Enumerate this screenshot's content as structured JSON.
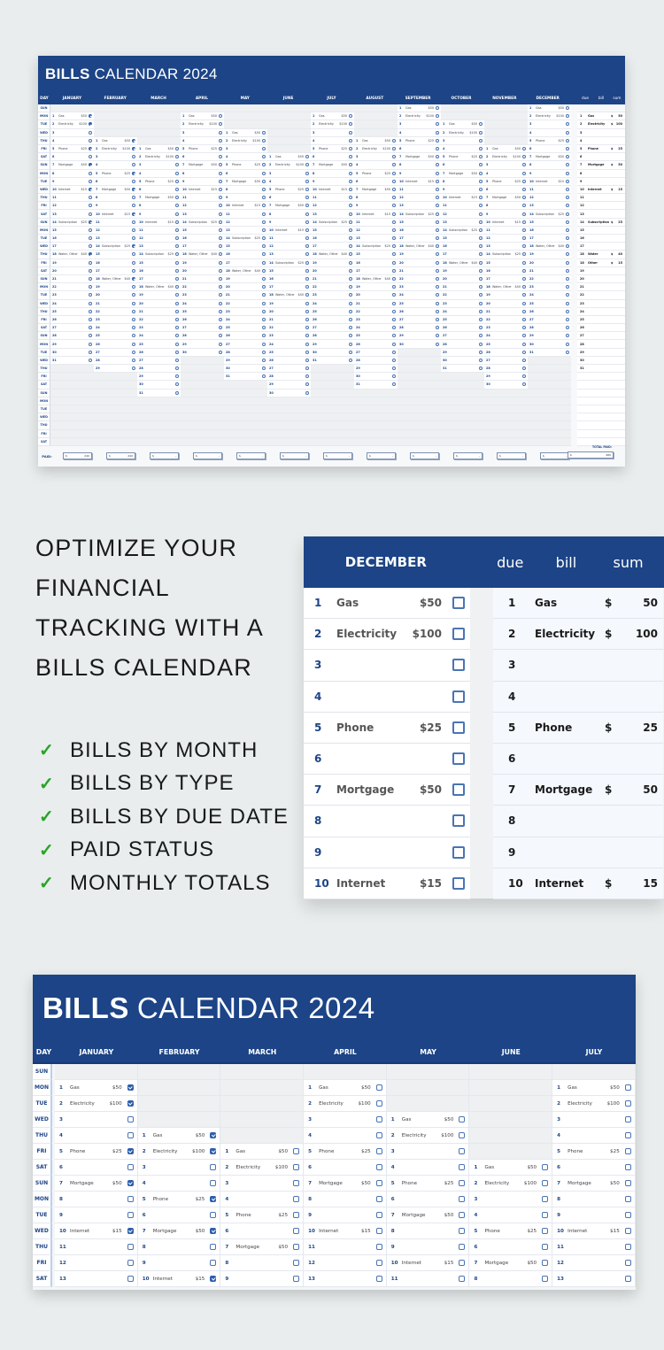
{
  "top_calendar": {
    "title_bold": "BILLS",
    "title_light": "CALENDAR 2024",
    "day_header": "DAY",
    "months": [
      "JANUARY",
      "FEBRUARY",
      "MARCH",
      "APRIL",
      "MAY",
      "JUNE",
      "JULY",
      "AUGUST",
      "SEPTEMBER",
      "OCTOBER",
      "NOVEMBER",
      "DECEMBER"
    ],
    "summary_headers": [
      "due",
      "bill",
      "sum"
    ],
    "weekdays": [
      "SUN",
      "MON",
      "TUE",
      "WED",
      "THU",
      "FRI",
      "SAT"
    ],
    "paid_label": "PAID:",
    "paid_values": [
      "$ 240",
      "$ 240",
      "$ -",
      "$ -",
      "$ -",
      "$ -",
      "$ -",
      "$ -",
      "$ -",
      "$ -",
      "$ -",
      "$ -"
    ],
    "total_paid_label": "TOTAL PAID:",
    "total_paid_value": "$ 480",
    "summary": [
      {
        "due": "1",
        "bill": "Gas",
        "cur": "$",
        "sum": "50"
      },
      {
        "due": "2",
        "bill": "Electricity",
        "cur": "$",
        "sum": "100"
      },
      {
        "due": "3",
        "bill": "",
        "cur": "",
        "sum": ""
      },
      {
        "due": "4",
        "bill": "",
        "cur": "",
        "sum": ""
      },
      {
        "due": "5",
        "bill": "Phone",
        "cur": "$",
        "sum": "25"
      },
      {
        "due": "6",
        "bill": "",
        "cur": "",
        "sum": ""
      },
      {
        "due": "7",
        "bill": "Mortgage",
        "cur": "$",
        "sum": "50"
      },
      {
        "due": "8",
        "bill": "",
        "cur": "",
        "sum": ""
      },
      {
        "due": "9",
        "bill": "",
        "cur": "",
        "sum": ""
      },
      {
        "due": "10",
        "bill": "Internet",
        "cur": "$",
        "sum": "15"
      },
      {
        "due": "11",
        "bill": "",
        "cur": "",
        "sum": ""
      },
      {
        "due": "12",
        "bill": "",
        "cur": "",
        "sum": ""
      },
      {
        "due": "13",
        "bill": "",
        "cur": "",
        "sum": ""
      },
      {
        "due": "14",
        "bill": "Subscription",
        "cur": "$",
        "sum": "25"
      },
      {
        "due": "15",
        "bill": "",
        "cur": "",
        "sum": ""
      },
      {
        "due": "16",
        "bill": "",
        "cur": "",
        "sum": ""
      },
      {
        "due": "17",
        "bill": "",
        "cur": "",
        "sum": ""
      },
      {
        "due": "18",
        "bill": "Water",
        "cur": "$",
        "sum": "40"
      },
      {
        "due": "18",
        "bill": "Other",
        "cur": "$",
        "sum": "15"
      },
      {
        "due": "19",
        "bill": "",
        "cur": "",
        "sum": ""
      },
      {
        "due": "20",
        "bill": "",
        "cur": "",
        "sum": ""
      },
      {
        "due": "21",
        "bill": "",
        "cur": "",
        "sum": ""
      },
      {
        "due": "22",
        "bill": "",
        "cur": "",
        "sum": ""
      },
      {
        "due": "23",
        "bill": "",
        "cur": "",
        "sum": ""
      },
      {
        "due": "24",
        "bill": "",
        "cur": "",
        "sum": ""
      },
      {
        "due": "25",
        "bill": "",
        "cur": "",
        "sum": ""
      },
      {
        "due": "26",
        "bill": "",
        "cur": "",
        "sum": ""
      },
      {
        "due": "27",
        "bill": "",
        "cur": "",
        "sum": ""
      },
      {
        "due": "28",
        "bill": "",
        "cur": "",
        "sum": ""
      },
      {
        "due": "29",
        "bill": "",
        "cur": "",
        "sum": ""
      },
      {
        "due": "30",
        "bill": "",
        "cur": "",
        "sum": ""
      },
      {
        "due": "31",
        "bill": "",
        "cur": "",
        "sum": ""
      }
    ]
  },
  "calendar_2024": {
    "month_start_weekday": [
      1,
      4,
      5,
      1,
      3,
      6,
      1,
      4,
      0,
      2,
      5,
      0
    ],
    "month_days": [
      31,
      29,
      31,
      30,
      31,
      30,
      31,
      31,
      30,
      31,
      30,
      31
    ],
    "checked_months": [
      0,
      1
    ],
    "bills": [
      {
        "day": 1,
        "name": "Gas",
        "amount": "$50"
      },
      {
        "day": 2,
        "name": "Electricity",
        "amount": "$100"
      },
      {
        "day": 5,
        "name": "Phone",
        "amount": "$25"
      },
      {
        "day": 7,
        "name": "Mortgage",
        "amount": "$50"
      },
      {
        "day": 10,
        "name": "Internet",
        "amount": "$15"
      },
      {
        "day": 14,
        "name": "Subscription",
        "amount": "$25"
      },
      {
        "day": 18,
        "name": "Water, Other",
        "amount": "$40"
      }
    ]
  },
  "marketing": {
    "headline_lines": [
      "OPTIMIZE YOUR",
      "FINANCIAL",
      "TRACKING WITH A",
      "BILLS CALENDAR"
    ],
    "check_icon": "✓",
    "features": [
      "BILLS BY MONTH",
      "BILLS BY TYPE",
      "BILLS BY DUE DATE",
      "PAID STATUS",
      "MONTHLY TOTALS"
    ]
  },
  "detail": {
    "month": "DECEMBER",
    "headers": [
      "due",
      "bill",
      "sum"
    ],
    "rows": [
      {
        "day": "1",
        "bill": "Gas",
        "amount": "$50",
        "cur": "$",
        "sum": "50"
      },
      {
        "day": "2",
        "bill": "Electricity",
        "amount": "$100",
        "cur": "$",
        "sum": "100"
      },
      {
        "day": "3",
        "bill": "",
        "amount": "",
        "cur": "",
        "sum": ""
      },
      {
        "day": "4",
        "bill": "",
        "amount": "",
        "cur": "",
        "sum": ""
      },
      {
        "day": "5",
        "bill": "Phone",
        "amount": "$25",
        "cur": "$",
        "sum": "25"
      },
      {
        "day": "6",
        "bill": "",
        "amount": "",
        "cur": "",
        "sum": ""
      },
      {
        "day": "7",
        "bill": "Mortgage",
        "amount": "$50",
        "cur": "$",
        "sum": "50"
      },
      {
        "day": "8",
        "bill": "",
        "amount": "",
        "cur": "",
        "sum": ""
      },
      {
        "day": "9",
        "bill": "",
        "amount": "",
        "cur": "",
        "sum": ""
      },
      {
        "day": "10",
        "bill": "Internet",
        "amount": "$15",
        "cur": "$",
        "sum": "15"
      }
    ]
  },
  "bottom_calendar": {
    "title_bold": "BILLS",
    "title_light": "CALENDAR 2024",
    "day_header": "DAY",
    "months": [
      "JANUARY",
      "FEBRUARY",
      "MARCH",
      "APRIL",
      "MAY",
      "JUNE",
      "JULY"
    ],
    "visible_rows": 14
  },
  "colors": {
    "navy": "#1c4486",
    "checkbox": "#2d5fae",
    "check_green": "#29a329",
    "background": "#e9eded"
  }
}
